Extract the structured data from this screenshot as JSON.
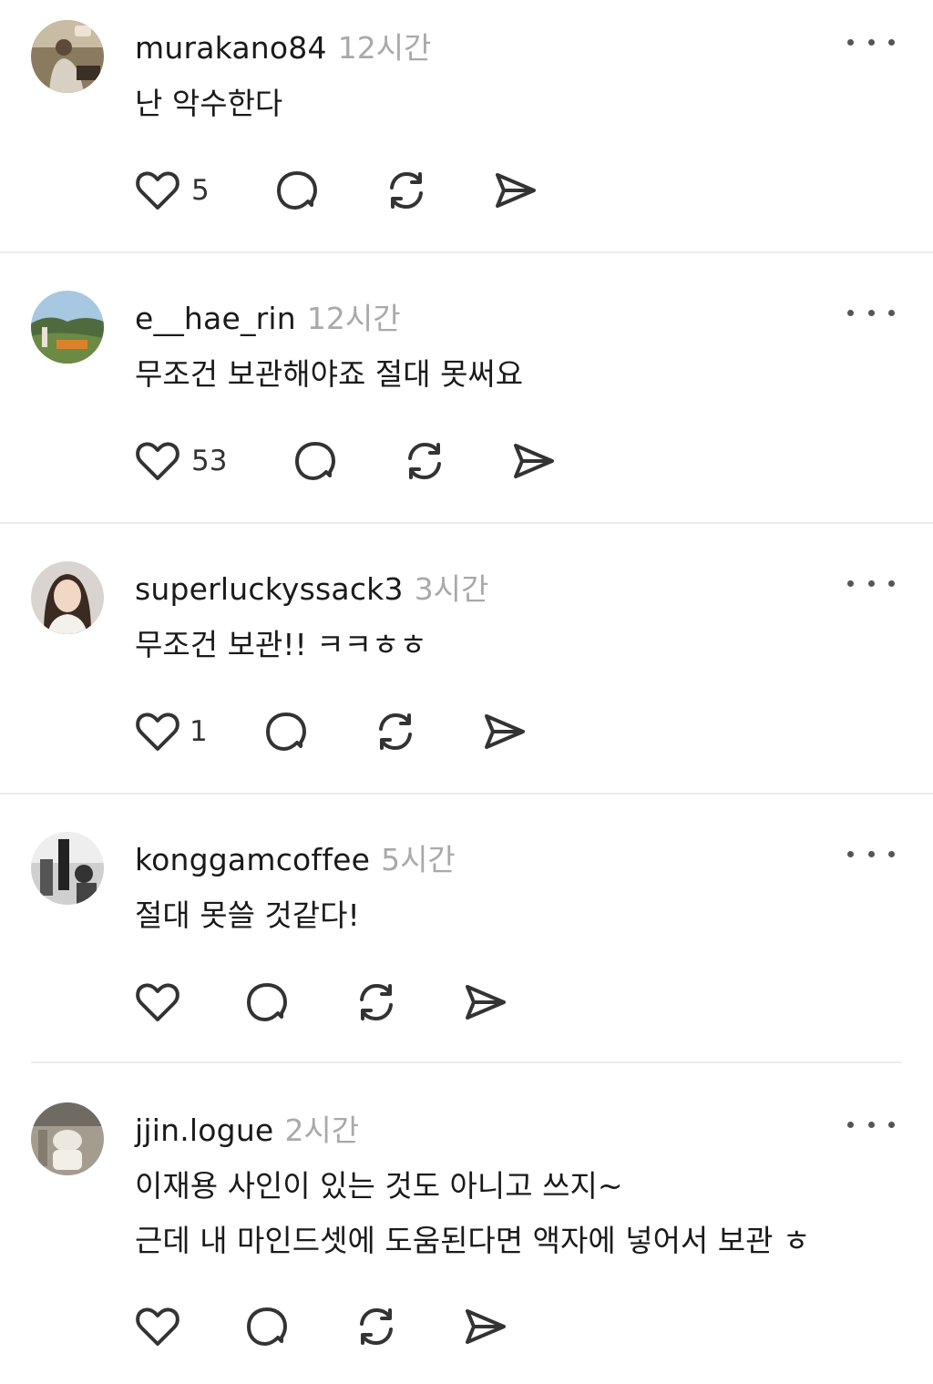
{
  "posts": [
    {
      "username": "murakano84",
      "time": "12시간",
      "lines": [
        "난 악수한다"
      ],
      "likes": "5"
    },
    {
      "username": "e__hae_rin",
      "time": "12시간",
      "lines": [
        "무조건 보관해야죠 절대 못써요"
      ],
      "likes": "53"
    },
    {
      "username": "superluckyssack3",
      "time": "3시간",
      "lines": [
        "무조건 보관!! ㅋㅋㅎㅎ"
      ],
      "likes": "1"
    },
    {
      "username": "konggamcoffee",
      "time": "5시간",
      "lines": [
        "절대 못쓸 것같다!"
      ],
      "likes": ""
    },
    {
      "username": "jjin.logue",
      "time": "2시간",
      "lines": [
        "이재용 사인이 있는 것도 아니고 쓰지~",
        "근데 내 마인드셋에 도움된다면 액자에 넣어서 보관 ㅎ"
      ],
      "likes": ""
    }
  ],
  "icons": {
    "like": "heart-icon",
    "reply": "comment-icon",
    "repost": "repost-icon",
    "share": "send-icon",
    "more": "more-icon"
  },
  "colors": {
    "text": "#1a1a1a",
    "muted": "#a9a9a9",
    "icon": "#333333",
    "divider": "#ececec"
  }
}
